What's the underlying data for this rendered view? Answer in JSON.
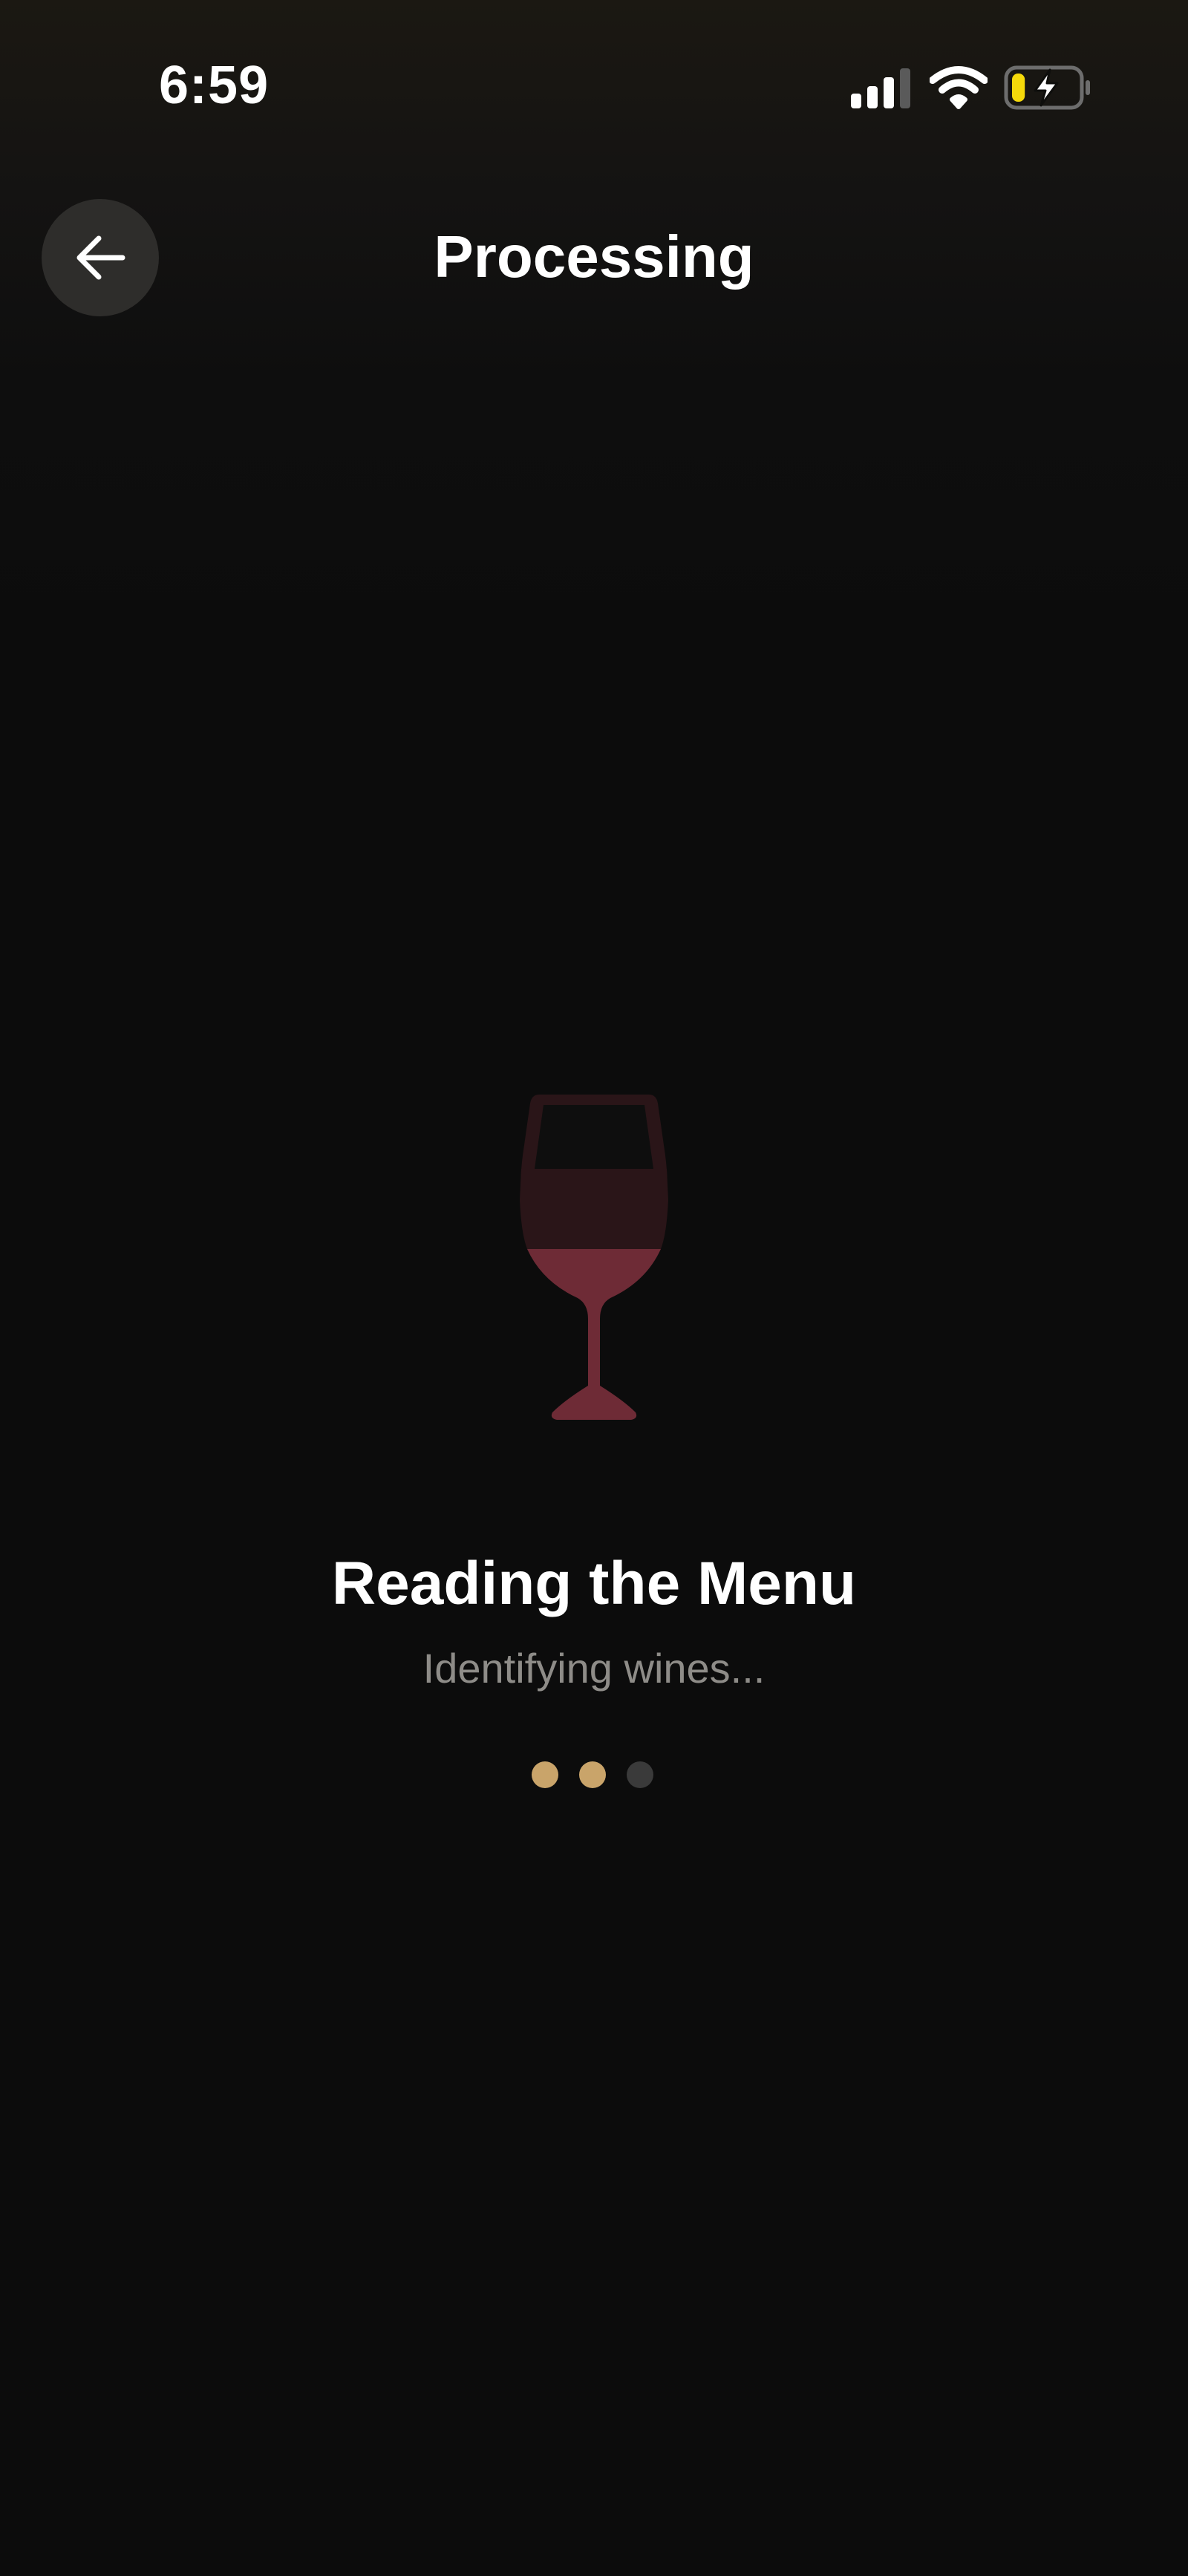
{
  "status_bar": {
    "time": "6:59",
    "icons": [
      "signal-icon",
      "wifi-icon",
      "battery-charging-icon"
    ],
    "battery_level": 0.2,
    "battery_color": "#f5d90a"
  },
  "header": {
    "back_icon": "arrow-left-icon",
    "title": "Processing"
  },
  "main": {
    "icon": "wine-glass-icon",
    "heading": "Reading the Menu",
    "subtext": "Identifying wines...",
    "progress": {
      "total_steps": 3,
      "completed_steps": 2,
      "active_color": "#c9a46a",
      "inactive_color": "#3a3a3a"
    }
  },
  "colors": {
    "background": "#0c0c0c",
    "wine": "#6e2b36",
    "glass": "#2a1518"
  }
}
